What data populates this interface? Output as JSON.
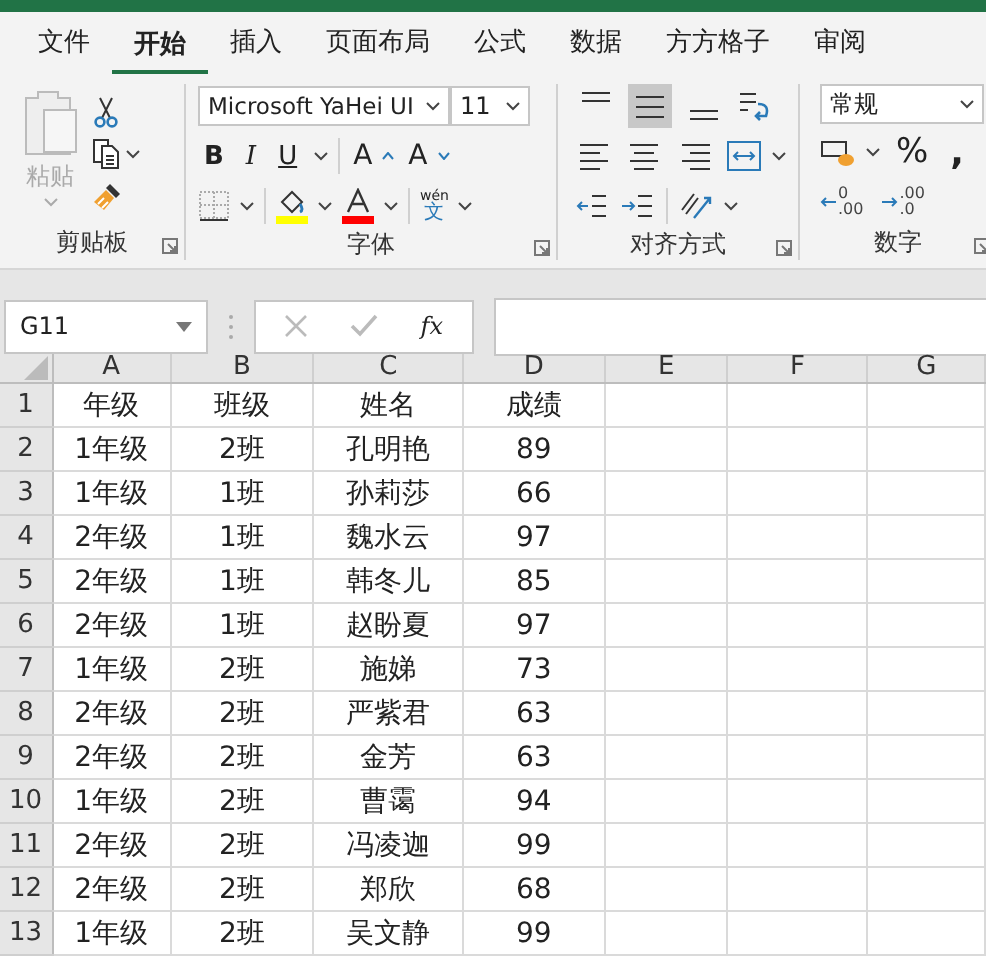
{
  "tabs": [
    {
      "label": "文件",
      "selected": false
    },
    {
      "label": "开始",
      "selected": true
    },
    {
      "label": "插入",
      "selected": false
    },
    {
      "label": "页面布局",
      "selected": false
    },
    {
      "label": "公式",
      "selected": false
    },
    {
      "label": "数据",
      "selected": false
    },
    {
      "label": "方方格子",
      "selected": false
    },
    {
      "label": "审阅",
      "selected": false
    }
  ],
  "clipboard": {
    "label": "剪贴板",
    "paste": "粘贴"
  },
  "font": {
    "label": "字体",
    "font_name": "Microsoft YaHei UI",
    "font_size": "11",
    "bold": "B",
    "italic": "I",
    "underline": "U",
    "grow": "A",
    "shrink": "A",
    "phonetic_top": "wén",
    "phonetic_bottom": "文"
  },
  "alignment": {
    "label": "对齐方式",
    "vertical": [
      {
        "kind": "top",
        "selected": false
      },
      {
        "kind": "middle",
        "selected": true
      },
      {
        "kind": "bottom",
        "selected": false
      }
    ],
    "horizontal": [
      {
        "kind": "left",
        "selected": false
      },
      {
        "kind": "center",
        "selected": false
      },
      {
        "kind": "right",
        "selected": false
      }
    ]
  },
  "number": {
    "label": "数字",
    "format": "常规",
    "percent": "%",
    "comma": ",",
    "increase_decimal": [
      "0",
      ".00"
    ],
    "decrease_decimal": [
      ".00",
      ".0"
    ]
  },
  "name_box": "G11",
  "fx": "fx",
  "columns": [
    "A",
    "B",
    "C",
    "D",
    "E",
    "F",
    "G"
  ],
  "rows": [
    {
      "number": "1",
      "cells": [
        "年级",
        "班级",
        "姓名",
        "成绩"
      ]
    },
    {
      "number": "2",
      "cells": [
        "1年级",
        "2班",
        "孔明艳",
        "89"
      ]
    },
    {
      "number": "3",
      "cells": [
        "1年级",
        "1班",
        "孙莉莎",
        "66"
      ]
    },
    {
      "number": "4",
      "cells": [
        "2年级",
        "1班",
        "魏水云",
        "97"
      ]
    },
    {
      "number": "5",
      "cells": [
        "2年级",
        "1班",
        "韩冬儿",
        "85"
      ]
    },
    {
      "number": "6",
      "cells": [
        "2年级",
        "1班",
        "赵盼夏",
        "97"
      ]
    },
    {
      "number": "7",
      "cells": [
        "1年级",
        "2班",
        "施娣",
        "73"
      ]
    },
    {
      "number": "8",
      "cells": [
        "2年级",
        "2班",
        "严紫君",
        "63"
      ]
    },
    {
      "number": "9",
      "cells": [
        "2年级",
        "2班",
        "金芳",
        "63"
      ]
    },
    {
      "number": "10",
      "cells": [
        "1年级",
        "2班",
        "曹霭",
        "94"
      ]
    },
    {
      "number": "11",
      "cells": [
        "2年级",
        "2班",
        "冯凌迦",
        "99"
      ]
    },
    {
      "number": "12",
      "cells": [
        "2年级",
        "2班",
        "郑欣",
        "68"
      ]
    },
    {
      "number": "13",
      "cells": [
        "1年级",
        "2班",
        "吴文静",
        "99"
      ]
    }
  ]
}
